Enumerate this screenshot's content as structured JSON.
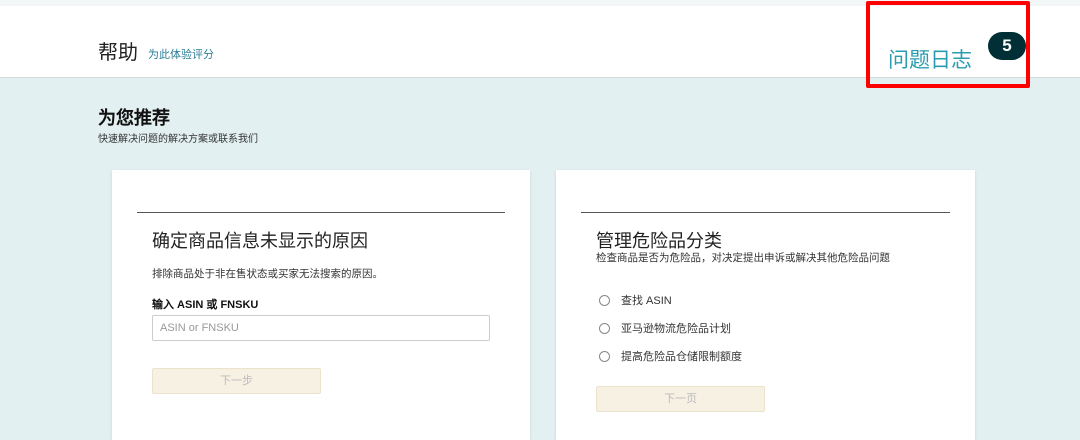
{
  "header": {
    "title": "帮助",
    "rate_link": "为此体验评分",
    "issue_log": "问题日志",
    "issue_count": "5"
  },
  "recommend": {
    "title": "为您推荐",
    "subtitle": "快速解决问题的解决方案或联系我们"
  },
  "card1": {
    "title": "确定商品信息未显示的原因",
    "desc": "排除商品处于非在售状态或买家无法搜索的原因。",
    "input_label": "输入 ASIN 或 FNSKU",
    "input_placeholder": "ASIN or FNSKU",
    "button": "下一步"
  },
  "card2": {
    "title": "管理危险品分类",
    "desc": "检查商品是否为危险品，对决定提出申诉或解决其他危险品问题",
    "options": [
      "查找 ASIN",
      "亚马逊物流危险品计划",
      "提高危险品仓储限制额度"
    ],
    "button": "下一页"
  }
}
